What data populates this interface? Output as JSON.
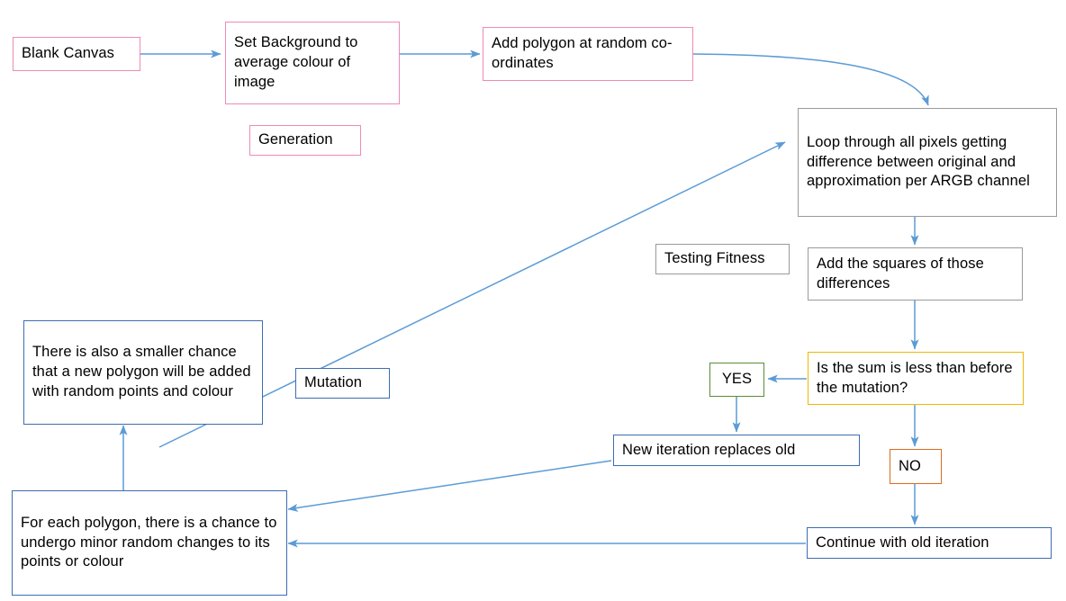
{
  "diagram": {
    "title": "Polygon image approximation genetic algorithm flowchart",
    "type": "flowchart",
    "colors": {
      "pink_border": "#ef8ab6",
      "gray_border": "#9a9a9a",
      "blue_border": "#3d6db0",
      "green_border": "#5b8c35",
      "orange_border": "#dd6b20",
      "yellow_border": "#f2b705",
      "arrow": "#5b9bd5",
      "text": "#000000",
      "background": "#ffffff"
    },
    "nodes": {
      "blank_canvas": "Blank Canvas",
      "set_background": "Set Background to average colour of image",
      "add_polygon": "Add polygon at random co-ordinates",
      "generation_label": "Generation",
      "loop_pixels": "Loop through all pixels getting difference between original and approximation per ARGB channel",
      "testing_fitness_label": "Testing Fitness",
      "add_squares": "Add the squares of those differences",
      "decision": "Is the sum is less than before the mutation?",
      "yes_label": "YES",
      "no_label": "NO",
      "new_iteration": "New iteration replaces old",
      "continue_old": "Continue with old iteration",
      "mutation_label": "Mutation",
      "smaller_chance": "There is also a smaller chance that a new polygon will be added with random points and colour",
      "each_polygon": "For each polygon, there is a chance to undergo minor random changes to its points or colour"
    },
    "edges": [
      {
        "from": "blank_canvas",
        "to": "set_background",
        "style": "straight-horizontal"
      },
      {
        "from": "set_background",
        "to": "add_polygon",
        "style": "straight-horizontal"
      },
      {
        "from": "add_polygon",
        "to": "loop_pixels",
        "style": "curved"
      },
      {
        "from": "loop_pixels",
        "to": "add_squares",
        "style": "straight-vertical"
      },
      {
        "from": "add_squares",
        "to": "decision",
        "style": "straight-vertical"
      },
      {
        "from": "decision",
        "to": "yes_label",
        "style": "straight-horizontal"
      },
      {
        "from": "decision",
        "to": "no_label",
        "style": "straight-vertical"
      },
      {
        "from": "yes_label",
        "to": "new_iteration",
        "style": "straight-vertical"
      },
      {
        "from": "no_label",
        "to": "continue_old",
        "style": "straight-vertical"
      },
      {
        "from": "new_iteration",
        "to": "each_polygon",
        "style": "diagonal"
      },
      {
        "from": "continue_old",
        "to": "each_polygon",
        "style": "straight-horizontal"
      },
      {
        "from": "each_polygon",
        "to": "smaller_chance",
        "style": "straight-vertical"
      },
      {
        "from": "smaller_chance",
        "to": "loop_pixels",
        "style": "diagonal"
      }
    ]
  }
}
